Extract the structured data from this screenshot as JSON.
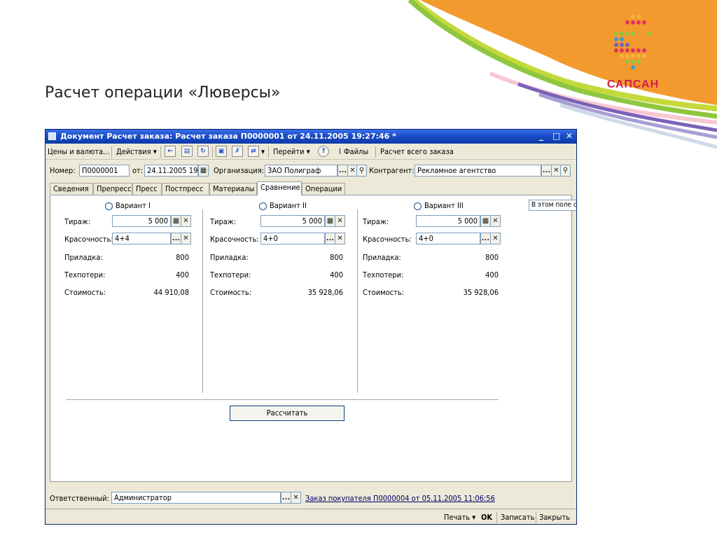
{
  "slide": {
    "title": "Расчет операции «Люверсы»",
    "logo_text": "САПСАН",
    "colors": {
      "orange": "#f39a2e",
      "logo_red": "#d21f49"
    }
  },
  "window": {
    "title": "Документ Расчет заказа: Расчет заказа П0000001 от 24.11.2005 19:27:46 *",
    "controls": {
      "minimize": "_",
      "maximize": "□",
      "close": "✕"
    }
  },
  "toolbar": {
    "prices": "Цены и валюта...",
    "actions": "Действия",
    "goto": "Перейти",
    "help": "?",
    "files": "Файлы",
    "calc_all": "Расчет всего заказа",
    "dropdown_glyph": "▾"
  },
  "header": {
    "number_label": "Номер:",
    "number_value": "П0000001",
    "date_label": "от:",
    "date_value": "24.11.2005 19:2",
    "org_label": "Организация:",
    "org_value": "ЗАО Полиграф",
    "contractor_label": "Контрагент:",
    "contractor_value": "Рекламное агентство"
  },
  "tabs": [
    {
      "label": "Сведения"
    },
    {
      "label": "Препресс"
    },
    {
      "label": "Пресс"
    },
    {
      "label": "Постпресс"
    },
    {
      "label": "Материалы"
    },
    {
      "label": "Сравнение"
    },
    {
      "label": "Операции"
    }
  ],
  "active_tab": "Сравнение",
  "labels": {
    "tirage": "Тираж:",
    "colors": "Красочность:",
    "makeready": "Приладка:",
    "waste": "Техпотери:",
    "cost": "Стоимость:"
  },
  "variants": [
    {
      "name": "Вариант I",
      "tirage": "5 000",
      "colors": "4+4",
      "makeready": "800",
      "waste": "400",
      "cost": "44 910,08"
    },
    {
      "name": "Вариант II",
      "tirage": "5 000",
      "colors": "4+0",
      "makeready": "800",
      "waste": "400",
      "cost": "35 928,06"
    },
    {
      "name": "Вариант III",
      "tirage": "5 000",
      "colors": "4+0",
      "makeready": "800",
      "waste": "400",
      "cost": "35 928,06"
    }
  ],
  "calculate_button": "Рассчитать",
  "hint": "В этом поле с",
  "footer": {
    "responsible_label": "Ответственный:",
    "responsible_value": "Администратор",
    "order_link": "Заказ покупателя П0000004 от 05.11.2005 11:06:56"
  },
  "bottom": {
    "print": "Печать",
    "ok": "OK",
    "save": "Записать",
    "close": "Закрыть"
  },
  "buttons": {
    "select": "...",
    "clear": "✕",
    "search": "⚲",
    "calc": "▦"
  }
}
